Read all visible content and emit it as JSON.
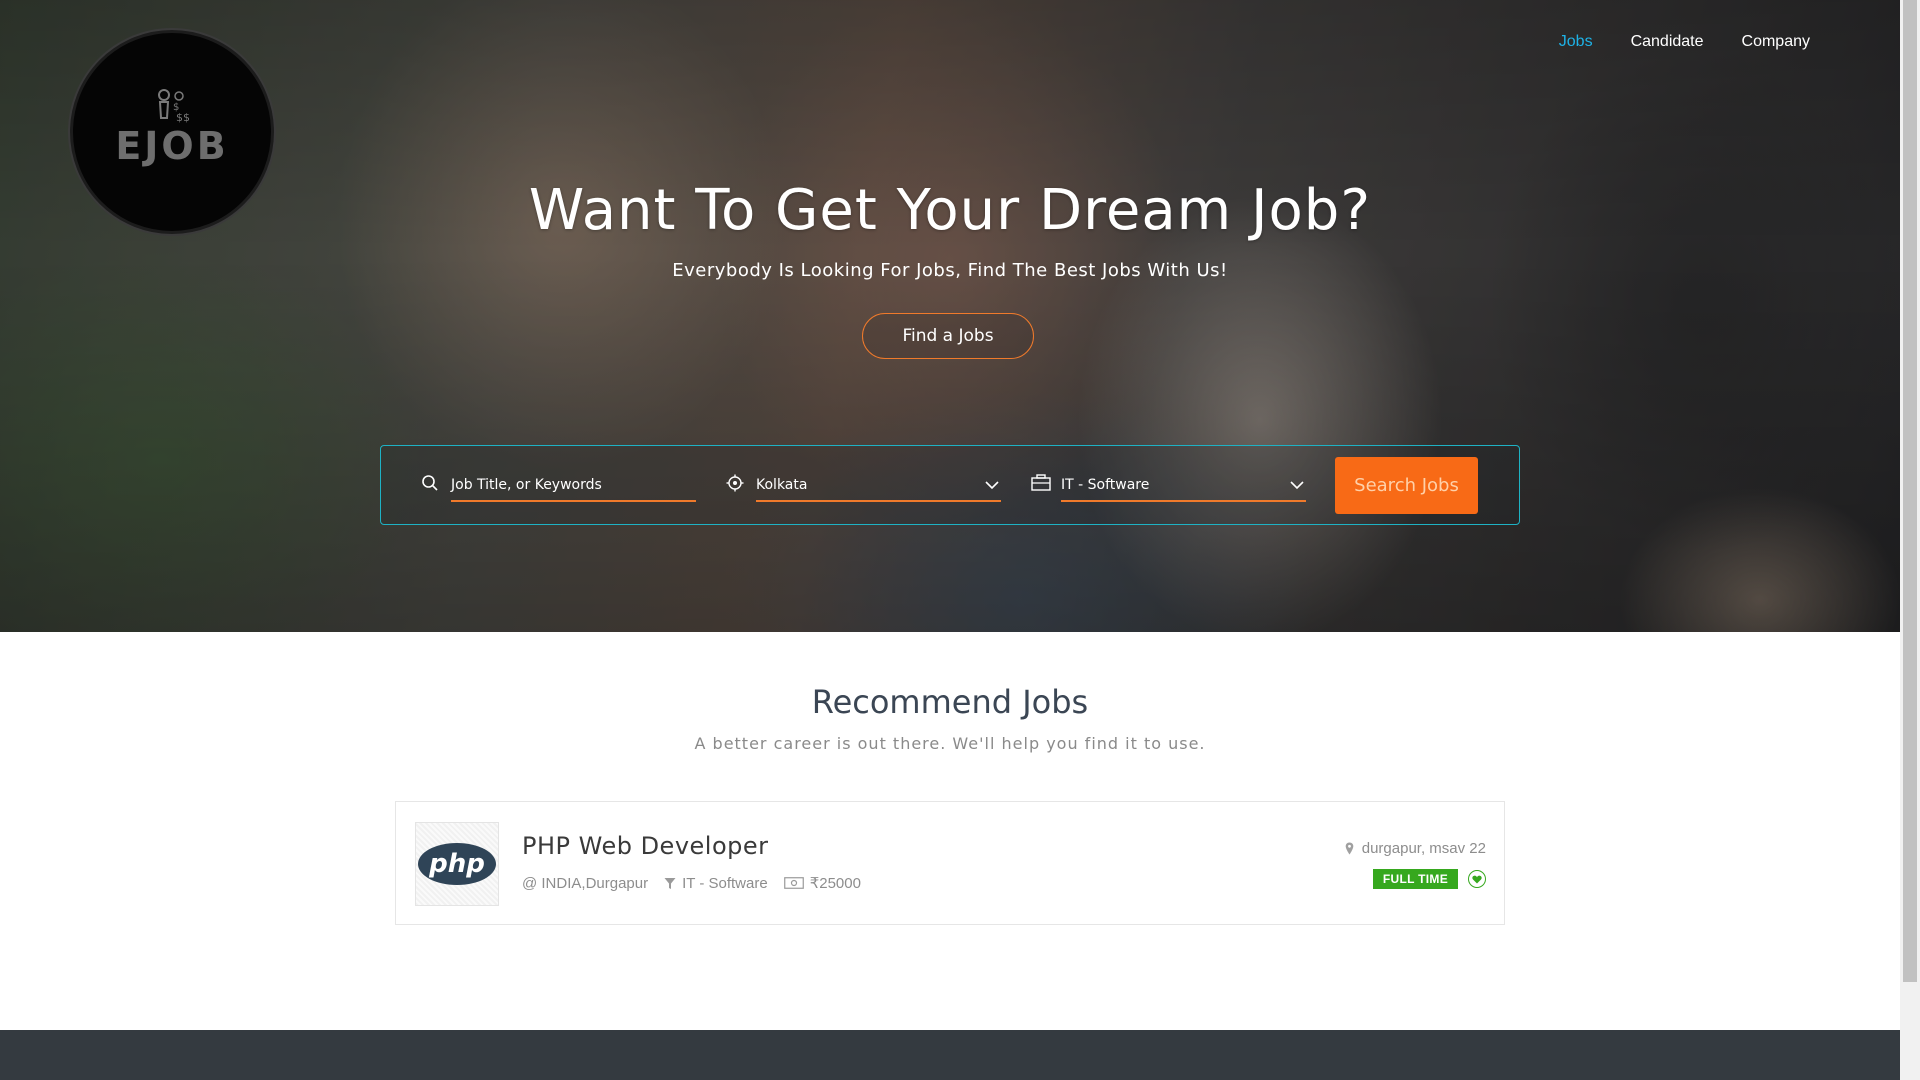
{
  "brand": {
    "logo_text": "EJOB"
  },
  "nav": {
    "items": [
      {
        "label": "Jobs",
        "active": true
      },
      {
        "label": "Candidate",
        "active": false
      },
      {
        "label": "Company",
        "active": false
      }
    ]
  },
  "hero": {
    "title": "Want To Get Your Dream Job?",
    "subtitle": "Everybody Is Looking For Jobs, Find The Best Jobs With Us!",
    "cta_label": "Find a Jobs"
  },
  "search": {
    "keyword_placeholder": "Job Title, or Keywords",
    "location_value": "Kolkata",
    "category_value": "IT - Software",
    "button_label": "Search Jobs"
  },
  "recommend": {
    "title": "Recommend Jobs",
    "subtitle": "A better career is out there. We'll help you find it to use.",
    "jobs": [
      {
        "logo_text": "php",
        "title": "PHP Web Developer",
        "company_location": "@ INDIA,Durgapur",
        "category": "IT - Software",
        "salary": "₹25000",
        "posted_location": "durgapur, msav 22",
        "type_badge": "FULL TIME"
      }
    ]
  },
  "colors": {
    "accent_blue": "#1eb2e6",
    "accent_orange": "#f86a16",
    "badge_green": "#36a81e",
    "footer": "#343a40"
  },
  "icons": [
    "search-icon",
    "location-target-icon",
    "briefcase-icon",
    "chevron-down-icon",
    "filter-icon",
    "money-icon",
    "map-pin-icon",
    "heart-icon"
  ]
}
